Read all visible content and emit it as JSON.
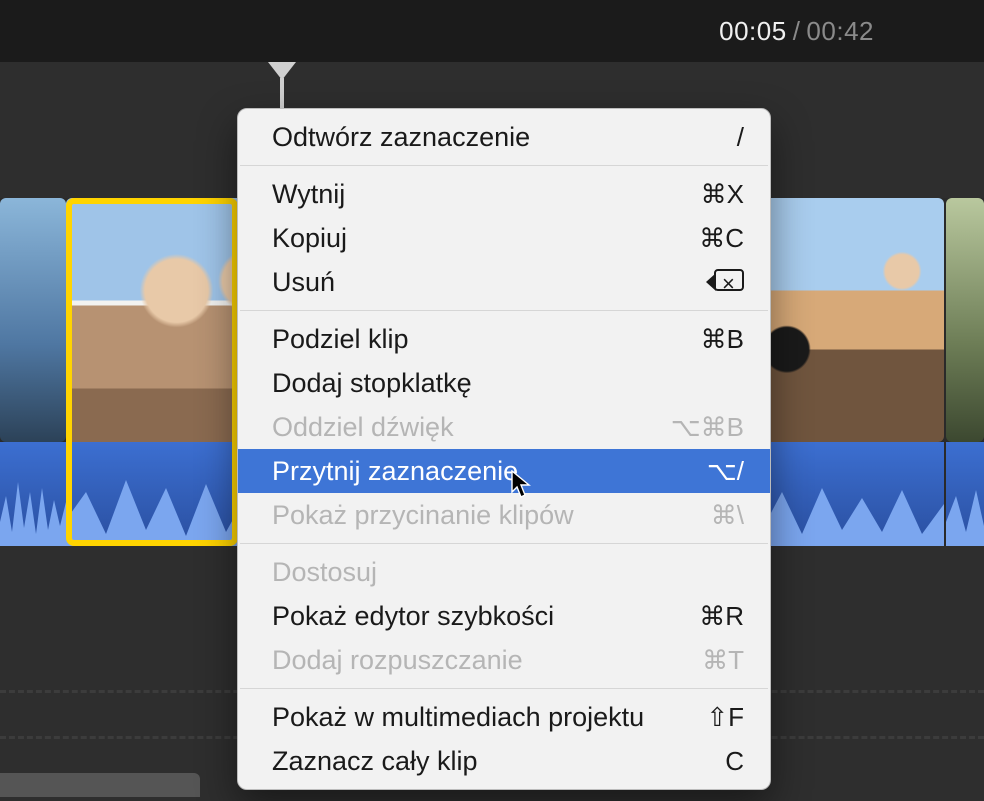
{
  "time": {
    "current": "00:05",
    "sep": "/",
    "total": "00:42"
  },
  "menu": {
    "groups": [
      [
        {
          "id": "play-selection",
          "label": "Odtwórz zaznaczenie",
          "shortcut": "/",
          "enabled": true
        }
      ],
      [
        {
          "id": "cut",
          "label": "Wytnij",
          "shortcut": "⌘X",
          "enabled": true
        },
        {
          "id": "copy",
          "label": "Kopiuj",
          "shortcut": "⌘C",
          "enabled": true
        },
        {
          "id": "delete",
          "label": "Usuń",
          "shortcut": "__delete_icon__",
          "enabled": true
        }
      ],
      [
        {
          "id": "split",
          "label": "Podziel klip",
          "shortcut": "⌘B",
          "enabled": true
        },
        {
          "id": "freeze",
          "label": "Dodaj stopklatkę",
          "shortcut": "",
          "enabled": true
        },
        {
          "id": "detach-audio",
          "label": "Oddziel dźwięk",
          "shortcut": "⌥⌘B",
          "enabled": false
        },
        {
          "id": "trim-selection",
          "label": "Przytnij zaznaczenie",
          "shortcut": "⌥/",
          "enabled": true,
          "highlight": true
        },
        {
          "id": "show-trim",
          "label": "Pokaż przycinanie klipów",
          "shortcut": "⌘\\",
          "enabled": false
        }
      ],
      [
        {
          "id": "adjust",
          "label": "Dostosuj",
          "shortcut": "",
          "enabled": false
        },
        {
          "id": "speed-editor",
          "label": "Pokaż edytor szybkości",
          "shortcut": "⌘R",
          "enabled": true
        },
        {
          "id": "add-dissolve",
          "label": "Dodaj rozpuszczanie",
          "shortcut": "⌘T",
          "enabled": false
        }
      ],
      [
        {
          "id": "reveal-media",
          "label": "Pokaż w multimediach projektu",
          "shortcut": "⇧F",
          "enabled": true
        },
        {
          "id": "select-all",
          "label": "Zaznacz cały klip",
          "shortcut": "C",
          "enabled": true
        }
      ]
    ]
  }
}
